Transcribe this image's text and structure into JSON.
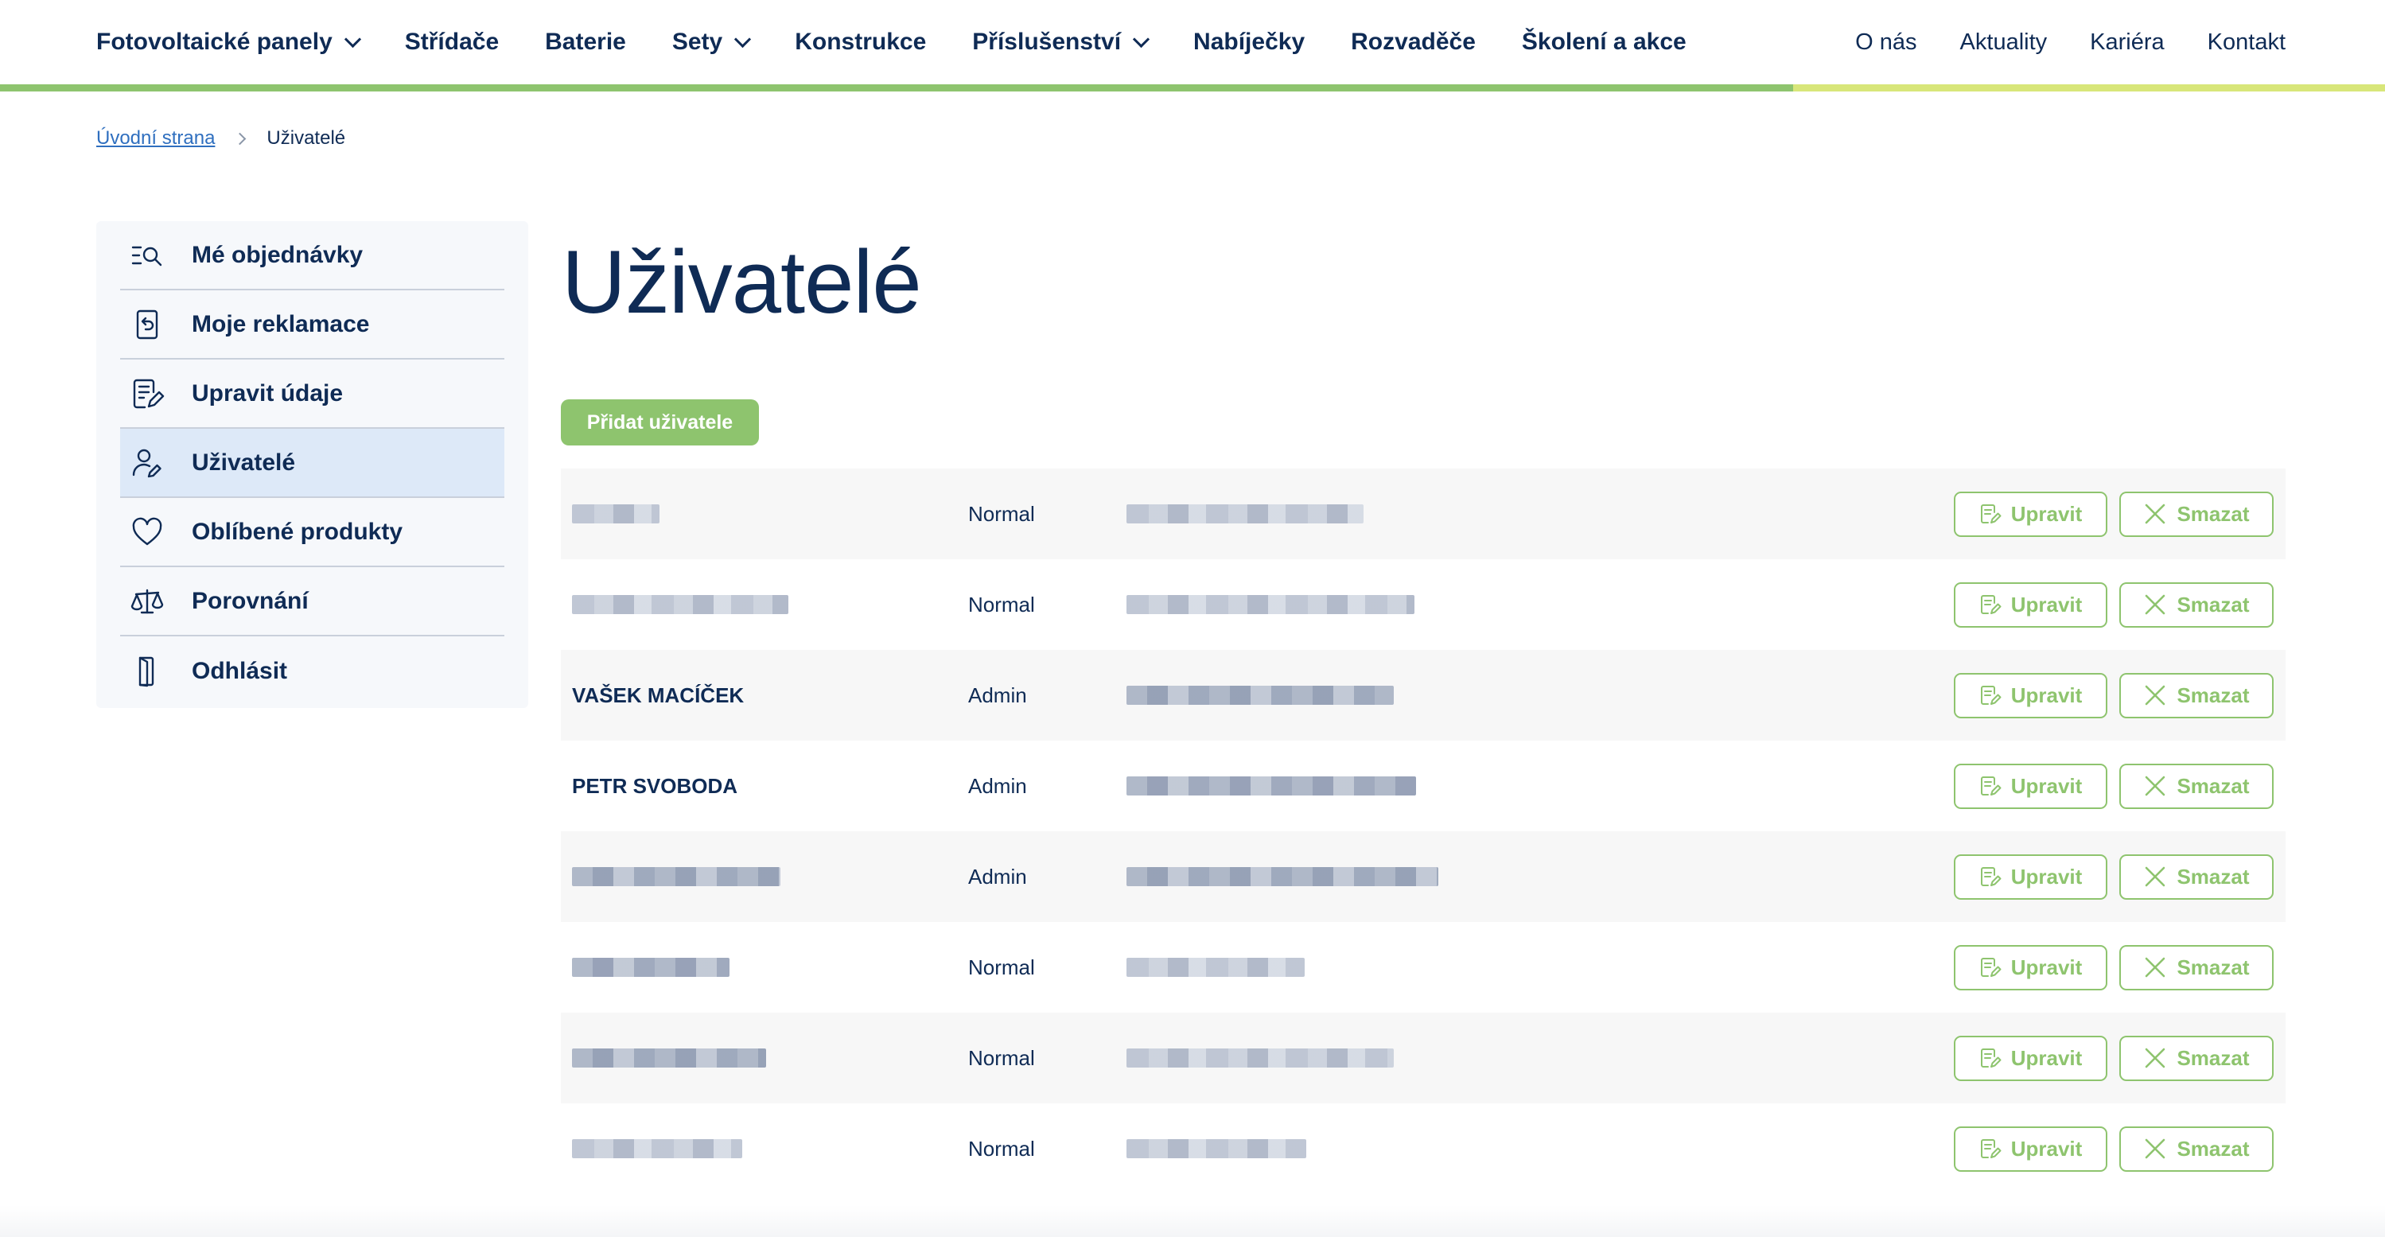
{
  "nav": {
    "main": [
      {
        "label": "Fotovoltaické panely",
        "has_dropdown": true
      },
      {
        "label": "Střídače",
        "has_dropdown": false
      },
      {
        "label": "Baterie",
        "has_dropdown": false
      },
      {
        "label": "Sety",
        "has_dropdown": true
      },
      {
        "label": "Konstrukce",
        "has_dropdown": false
      },
      {
        "label": "Příslušenství",
        "has_dropdown": true
      },
      {
        "label": "Nabíječky",
        "has_dropdown": false
      },
      {
        "label": "Rozvaděče",
        "has_dropdown": false
      },
      {
        "label": "Školení a akce",
        "has_dropdown": false
      }
    ],
    "secondary": [
      "O nás",
      "Aktuality",
      "Kariéra",
      "Kontakt"
    ]
  },
  "breadcrumb": {
    "home": "Úvodní strana",
    "current": "Uživatelé"
  },
  "sidebar": {
    "items": [
      {
        "label": "Mé objednávky",
        "icon": "orders-search-icon",
        "active": false
      },
      {
        "label": "Moje reklamace",
        "icon": "return-document-icon",
        "active": false
      },
      {
        "label": "Upravit údaje",
        "icon": "edit-document-icon",
        "active": false
      },
      {
        "label": "Uživatelé",
        "icon": "user-edit-icon",
        "active": true
      },
      {
        "label": "Oblíbené produkty",
        "icon": "heart-icon",
        "active": false
      },
      {
        "label": "Porovnání",
        "icon": "scales-icon",
        "active": false
      },
      {
        "label": "Odhlásit",
        "icon": "logout-door-icon",
        "active": false
      }
    ]
  },
  "page": {
    "title": "Uživatelé",
    "add_button": "Přidat uživatele"
  },
  "table": {
    "edit_label": "Upravit",
    "delete_label": "Smazat",
    "rows": [
      {
        "name": "",
        "name_redacted": true,
        "role": "Normal",
        "email_redacted": true
      },
      {
        "name": "",
        "name_redacted": true,
        "role": "Normal",
        "email_redacted": true
      },
      {
        "name": "VAŠEK MACÍČEK",
        "name_redacted": false,
        "role": "Admin",
        "email_redacted": true
      },
      {
        "name": "PETR SVOBODA",
        "name_redacted": false,
        "role": "Admin",
        "email_redacted": true
      },
      {
        "name": "",
        "name_redacted": true,
        "role": "Admin",
        "email_redacted": true
      },
      {
        "name": "",
        "name_redacted": true,
        "role": "Normal",
        "email_redacted": true
      },
      {
        "name": "",
        "name_redacted": true,
        "role": "Normal",
        "email_redacted": true
      },
      {
        "name": "",
        "name_redacted": true,
        "role": "Normal",
        "email_redacted": true
      }
    ]
  },
  "colors": {
    "brand_navy": "#0f2b55",
    "accent_green": "#8ec46e",
    "accent_yellow": "#d8e67a",
    "sidebar_active": "#dde9f8",
    "link_blue": "#2f6fbf"
  }
}
